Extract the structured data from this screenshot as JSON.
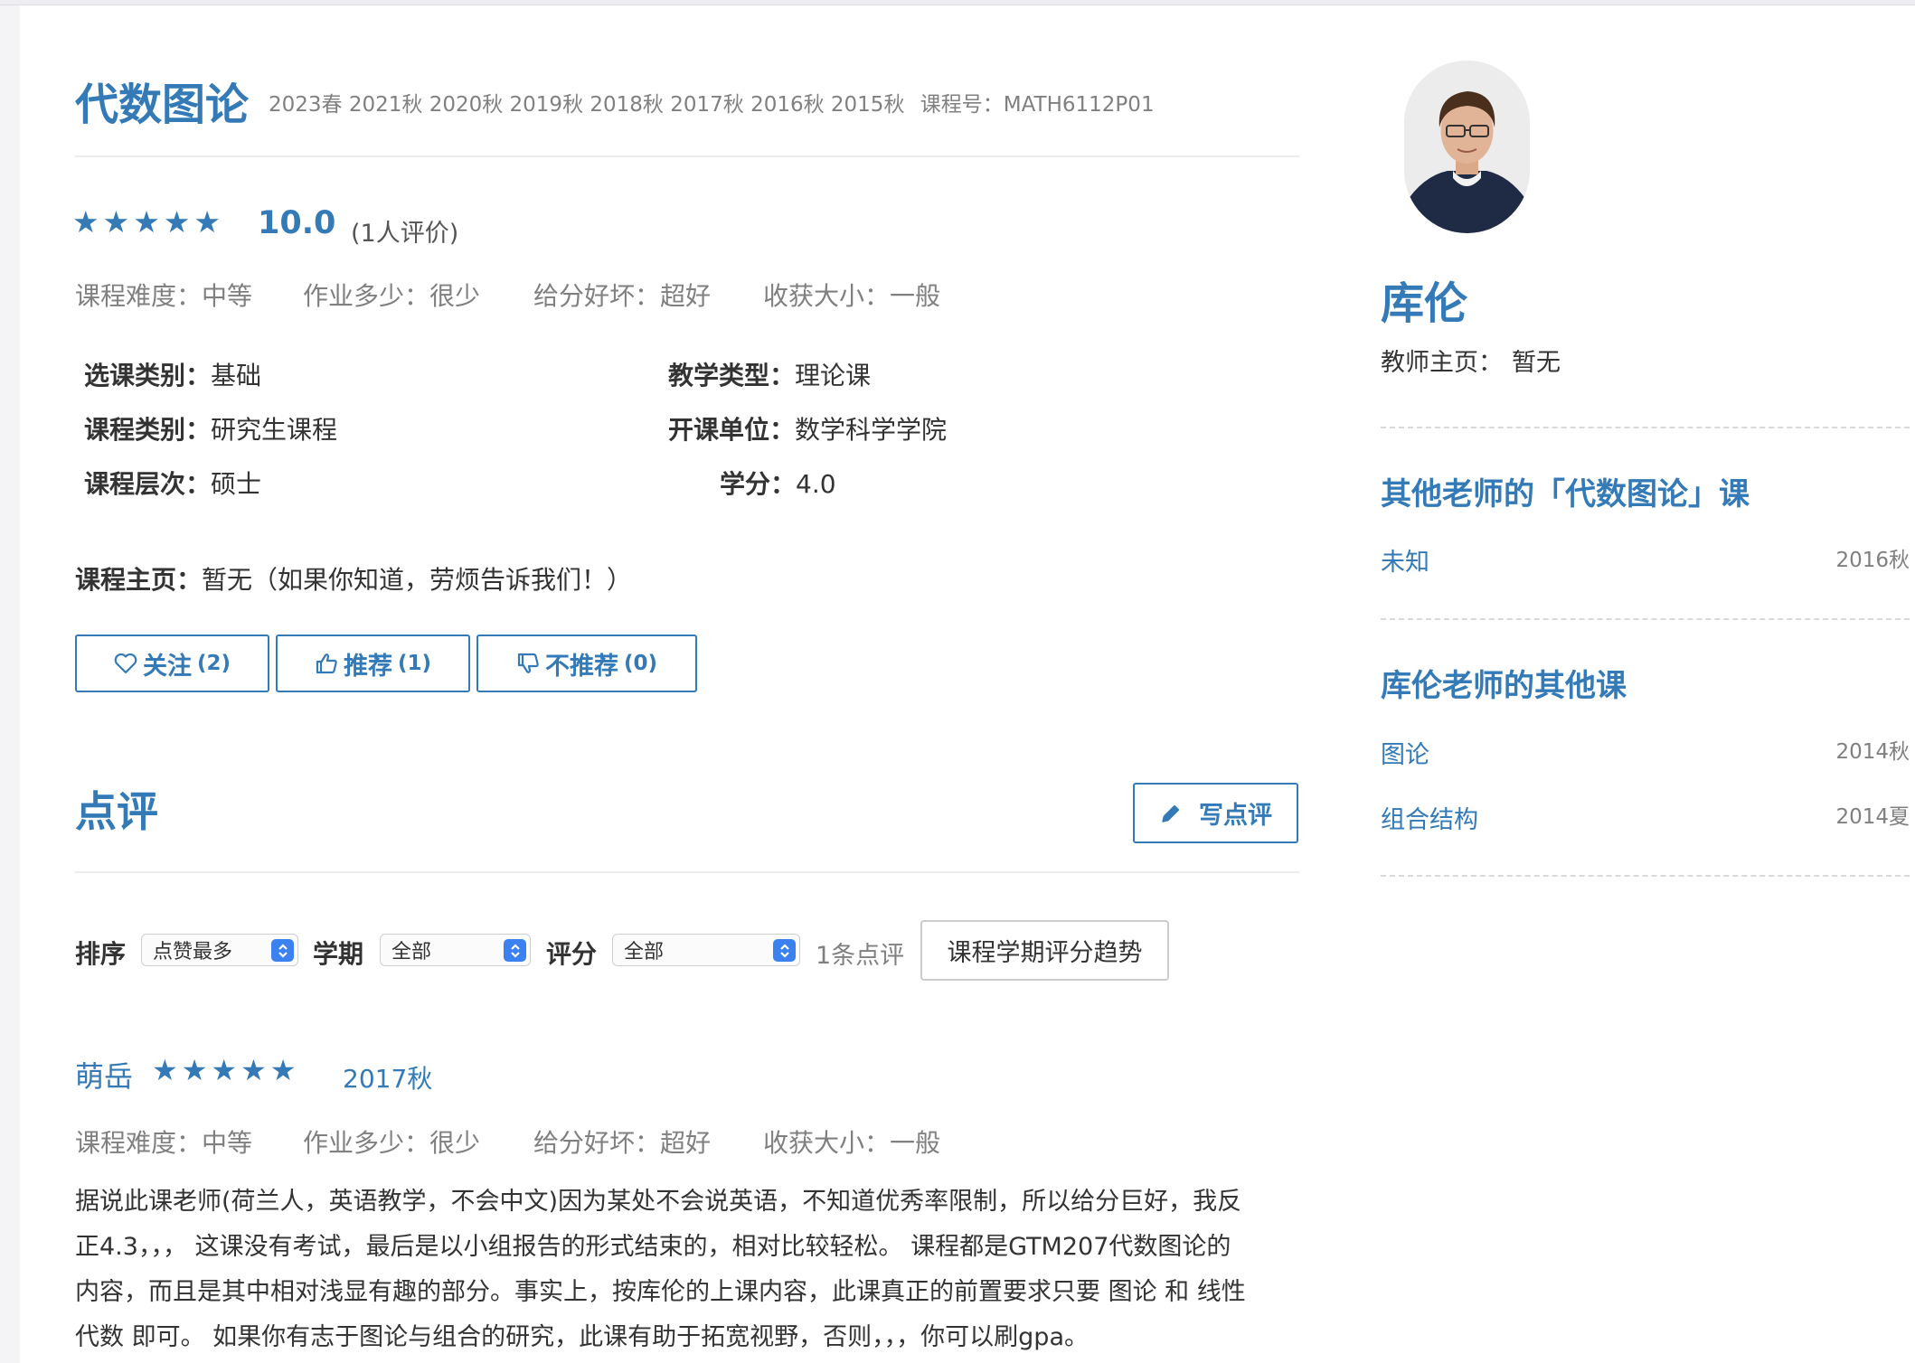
{
  "course": {
    "title": "代数图论",
    "terms": "2023春 2021秋 2020秋 2019秋 2018秋 2017秋 2016秋 2015秋",
    "code_label": "课程号：",
    "code": "MATH6112P01",
    "rating": {
      "stars": 5,
      "score": "10.0",
      "count_text": "(1人评价)"
    },
    "metrics": [
      {
        "label": "课程难度：",
        "value": "中等"
      },
      {
        "label": "作业多少：",
        "value": "很少"
      },
      {
        "label": "给分好坏：",
        "value": "超好"
      },
      {
        "label": "收获大小：",
        "value": "一般"
      }
    ],
    "info": [
      {
        "label": "选课类别：",
        "value": "基础"
      },
      {
        "label": "教学类型：",
        "value": "理论课"
      },
      {
        "label": "课程类别：",
        "value": "研究生课程"
      },
      {
        "label": "开课单位：",
        "value": "数学科学学院"
      },
      {
        "label": "课程层次：",
        "value": "硕士"
      },
      {
        "label": "学分：",
        "value": "4.0"
      }
    ],
    "homepage_label": "课程主页：",
    "homepage_value": "暂无（如果你知道，劳烦告诉我们！）",
    "actions": {
      "follow_label": "关注",
      "follow_count": "(2)",
      "recommend_label": "推荐",
      "recommend_count": "(1)",
      "not_recommend_label": "不推荐",
      "not_recommend_count": "(0)"
    }
  },
  "reviews_section": {
    "title": "点评",
    "write_label": "写点评",
    "filters": {
      "sort_label": "排序",
      "sort_value": "点赞最多",
      "term_label": "学期",
      "term_value": "全部",
      "score_label": "评分",
      "score_value": "全部",
      "count_text": "1条点评",
      "trend_button": "课程学期评分趋势"
    },
    "reviews": [
      {
        "author": "萌岳",
        "stars": 5,
        "term": "2017秋",
        "metrics": [
          {
            "label": "课程难度：",
            "value": "中等"
          },
          {
            "label": "作业多少：",
            "value": "很少"
          },
          {
            "label": "给分好坏：",
            "value": "超好"
          },
          {
            "label": "收获大小：",
            "value": "一般"
          }
        ],
        "lines": [
          "据说此课老师(荷兰人，英语教学，不会中文)因为某处不会说英语，不知道优秀率限制，所以给分巨好，我反",
          "正4.3，，， 这课没有考试，最后是以小组报告的形式结束的，相对比较轻松。 课程都是GTM207代数图论的",
          "内容，而且是其中相对浅显有趣的部分。事实上，按库伦的上课内容，此课真正的前置要求只要 图论 和 线性",
          "代数 即可。 如果你有志于图论与组合的研究，此课有助于拓宽视野，否则，，，你可以刷gpa。"
        ]
      }
    ]
  },
  "teacher": {
    "name": "库伦",
    "homepage_label": "教师主页：",
    "homepage_value": "暂无",
    "other_teachers_title": "其他老师的「代数图论」课",
    "other_teachers": [
      {
        "name": "未知",
        "term": "2016秋"
      }
    ],
    "other_courses_title": "库伦老师的其他课",
    "other_courses": [
      {
        "name": "图论",
        "term": "2014秋"
      },
      {
        "name": "组合结构",
        "term": "2014夏"
      }
    ]
  },
  "colors": {
    "accent": "#337ab7",
    "muted": "#808080",
    "select_arrow": "#3b82f0"
  }
}
